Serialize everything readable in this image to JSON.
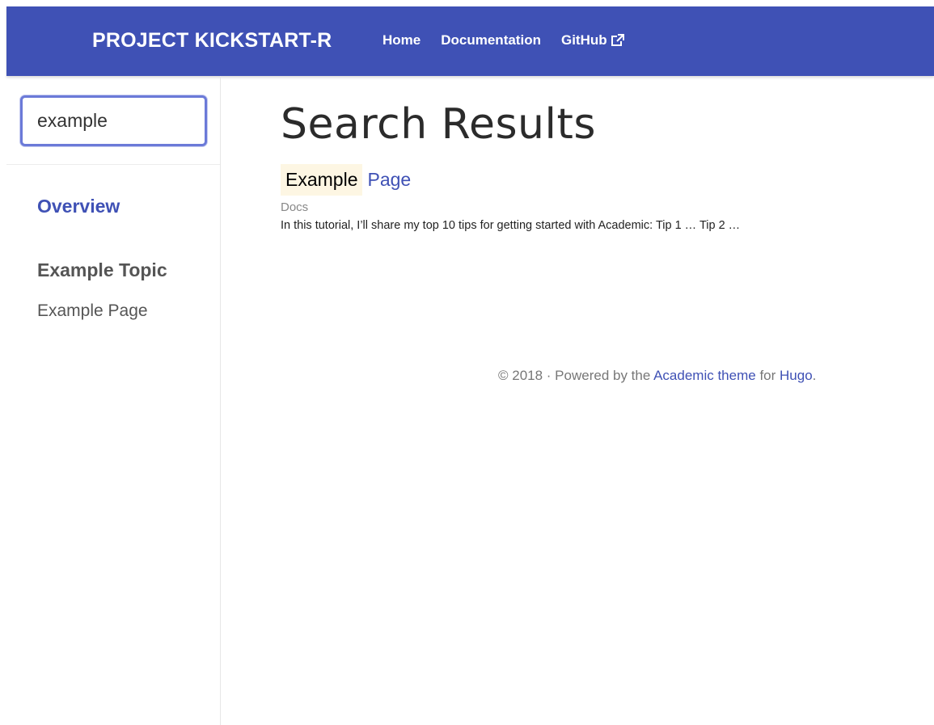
{
  "navbar": {
    "brand": "PROJECT KICKSTART-R",
    "links": [
      {
        "label": "Home"
      },
      {
        "label": "Documentation"
      },
      {
        "label": "GitHub",
        "icon": "external-link-icon"
      }
    ],
    "color": "#3f51b5"
  },
  "sidebar": {
    "search": {
      "value": "example"
    },
    "overview": "Overview",
    "topic": "Example Topic",
    "page": "Example Page"
  },
  "main": {
    "title": "Search Results",
    "results": [
      {
        "title_highlight": "Example",
        "title_rest": "Page",
        "section": "Docs",
        "summary": "In this tutorial, I’ll share my top 10 tips for getting started with Academic: Tip 1 … Tip 2 …"
      }
    ]
  },
  "footer": {
    "prefix": "© 2018 · Powered by the ",
    "theme_link": "Academic theme",
    "middle": " for ",
    "hugo_link": "Hugo",
    "suffix": "."
  }
}
